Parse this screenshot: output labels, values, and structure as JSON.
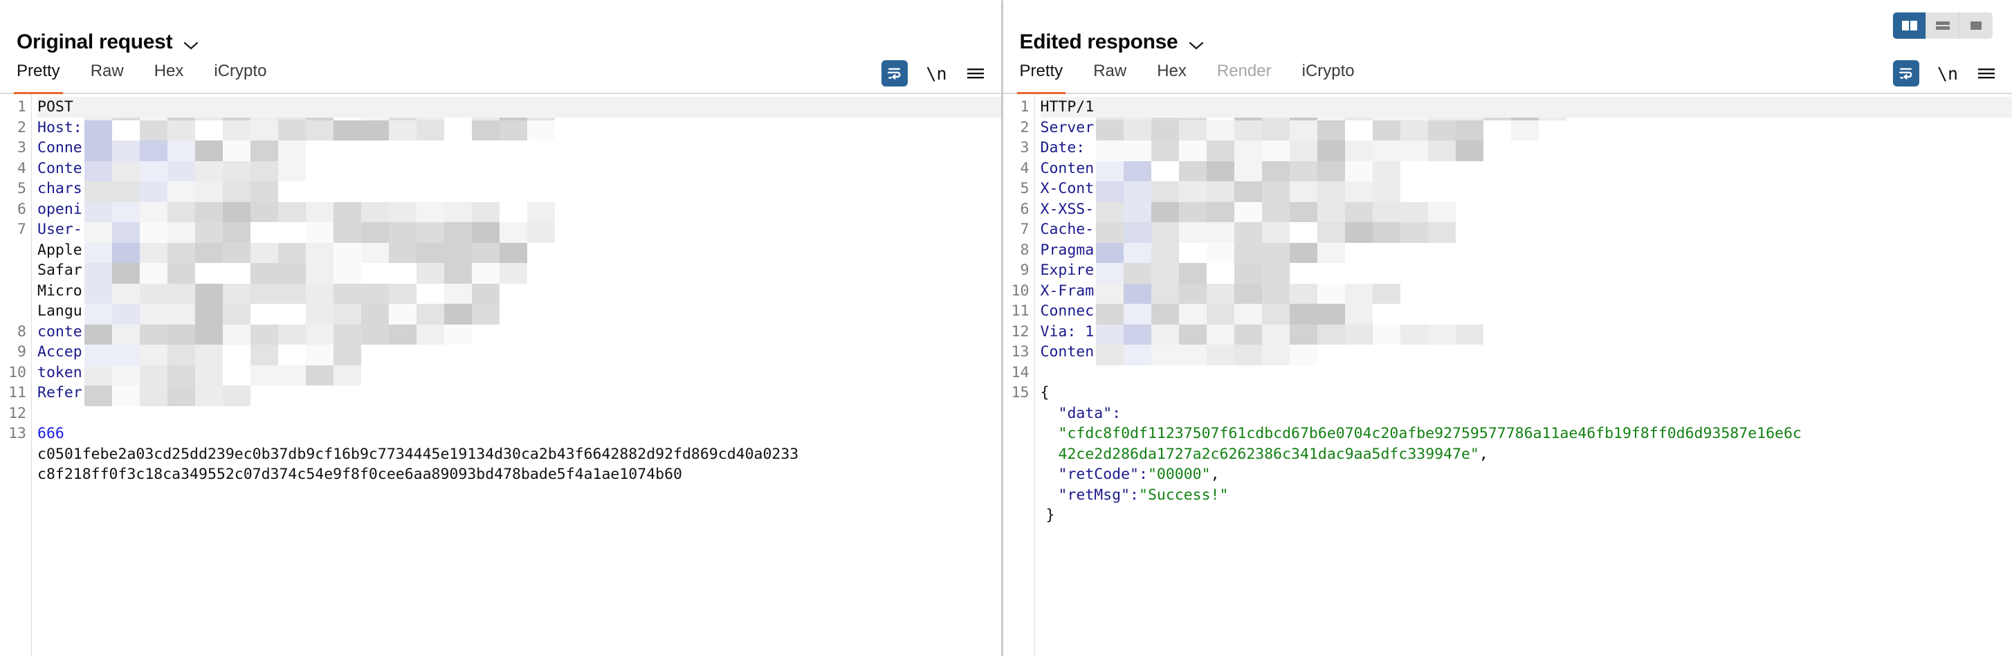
{
  "window": {
    "layout_buttons": [
      {
        "name": "side-by-side",
        "label": "",
        "active": true
      },
      {
        "name": "stacked",
        "label": "",
        "active": false
      },
      {
        "name": "single-pane",
        "label": "",
        "active": false
      }
    ]
  },
  "left_pane": {
    "title": "Original request",
    "tabs": [
      {
        "label": "Pretty",
        "active": true,
        "disabled": false
      },
      {
        "label": "Raw",
        "active": false,
        "disabled": false
      },
      {
        "label": "Hex",
        "active": false,
        "disabled": false
      },
      {
        "label": "iCrypto",
        "active": false,
        "disabled": false
      }
    ],
    "tools": {
      "wrap_icon": "word-wrap-icon",
      "newline_label": "\\n",
      "menu_icon": "hamburger-menu-icon"
    },
    "lines": [
      {
        "num": "1",
        "text": "POST",
        "style": "plain",
        "first": true,
        "censored": true
      },
      {
        "num": "2",
        "text": "Host:",
        "style": "key",
        "censored": true
      },
      {
        "num": "3",
        "text": "Conne",
        "style": "key",
        "censored": true
      },
      {
        "num": "4",
        "text": "Conte",
        "style": "key",
        "censored": true
      },
      {
        "num": "5",
        "text": "chars",
        "style": "key",
        "censored": true
      },
      {
        "num": "6",
        "text": "openi",
        "style": "key",
        "censored": true
      },
      {
        "num": "7",
        "text": "User-",
        "style": "key",
        "censored": true
      },
      {
        "num": "",
        "text": "Apple",
        "style": "plain",
        "censored": true
      },
      {
        "num": "",
        "text": "Safar",
        "style": "plain",
        "censored": true
      },
      {
        "num": "",
        "text": "Micro",
        "style": "plain",
        "censored": true
      },
      {
        "num": "",
        "text": "Langu",
        "style": "plain",
        "censored": true
      },
      {
        "num": "8",
        "text": "conte",
        "style": "key",
        "censored": true
      },
      {
        "num": "9",
        "text": "Accep",
        "style": "key",
        "censored": true
      },
      {
        "num": "10",
        "text": "token",
        "style": "key",
        "censored": true
      },
      {
        "num": "11",
        "text": "Refer",
        "style": "key",
        "censored": true
      },
      {
        "num": "12",
        "text": "",
        "style": "plain",
        "censored": false
      },
      {
        "num": "13",
        "text": "666",
        "style": "blue",
        "censored": false
      },
      {
        "num": "",
        "text": "c0501febe2a03cd25dd239ec0b37db9cf16b9c7734445e19134d30ca2b43f6642882d92fd869cd40a0233",
        "style": "plain",
        "censored": false
      },
      {
        "num": "",
        "text": "c8f218ff0f3c18ca349552c07d374c54e9f8f0cee6aa89093bd478bade5f4a1ae1074b60",
        "style": "plain",
        "censored": false
      }
    ]
  },
  "right_pane": {
    "title": "Edited response",
    "tabs": [
      {
        "label": "Pretty",
        "active": true,
        "disabled": false
      },
      {
        "label": "Raw",
        "active": false,
        "disabled": false
      },
      {
        "label": "Hex",
        "active": false,
        "disabled": false
      },
      {
        "label": "Render",
        "active": false,
        "disabled": true
      },
      {
        "label": "iCrypto",
        "active": false,
        "disabled": false
      }
    ],
    "tools": {
      "wrap_icon": "word-wrap-icon",
      "newline_label": "\\n",
      "menu_icon": "hamburger-menu-icon"
    },
    "lines": [
      {
        "num": "1",
        "text": "HTTP/1",
        "style": "plain",
        "first": true,
        "censored": true
      },
      {
        "num": "2",
        "text": "Server",
        "style": "key",
        "censored": true
      },
      {
        "num": "3",
        "text": "Date: ",
        "style": "key",
        "censored": true
      },
      {
        "num": "4",
        "text": "Conten",
        "style": "key",
        "censored": true
      },
      {
        "num": "5",
        "text": "X-Cont",
        "style": "key",
        "censored": true
      },
      {
        "num": "6",
        "text": "X-XSS-",
        "style": "key",
        "censored": true
      },
      {
        "num": "7",
        "text": "Cache-",
        "style": "key",
        "censored": true
      },
      {
        "num": "8",
        "text": "Pragma",
        "style": "key",
        "censored": true
      },
      {
        "num": "9",
        "text": "Expire",
        "style": "key",
        "censored": true
      },
      {
        "num": "10",
        "text": "X-Fram",
        "style": "key",
        "censored": true
      },
      {
        "num": "11",
        "text": "Connec",
        "style": "key",
        "censored": true
      },
      {
        "num": "12",
        "text": "Via: 1",
        "style": "key",
        "censored": true
      },
      {
        "num": "13",
        "text": "Conten",
        "style": "key",
        "censored": true
      },
      {
        "num": "14",
        "text": "",
        "style": "plain",
        "censored": false
      },
      {
        "num": "15",
        "text": "{",
        "style": "punct",
        "censored": false
      }
    ],
    "body": {
      "data_key": "\"data\":",
      "data_value_line1": "\"cfdc8f0df11237507f61cdbcd67b6e0704c20afbe92759577786a11ae46fb19f8ff0d6d93587e16e6c",
      "data_value_line2": "42ce2d286da1727a2c6262386c341dac9aa5dfc339947e\"",
      "data_value_comma": ",",
      "retcode_key": "\"retCode\":",
      "retcode_value": "\"00000\"",
      "retcode_comma": ",",
      "retmsg_key": "\"retMsg\":",
      "retmsg_value": "\"Success!\"",
      "close_brace": "}"
    }
  },
  "colors": {
    "accent_orange": "#e8662c",
    "accent_blue": "#2a6496",
    "header_key": "#1a1a8c",
    "json_string": "#128012",
    "gutter_text": "#7c7c7c"
  }
}
